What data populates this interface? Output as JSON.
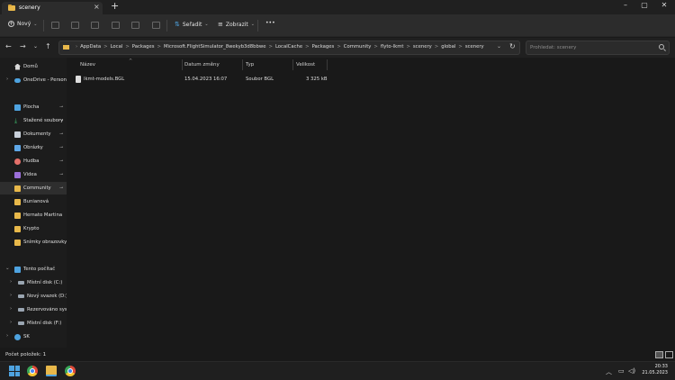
{
  "tab": {
    "title": "scenery",
    "close_label": "×",
    "new_tab_label": "+"
  },
  "window_controls": {
    "minimize": "–",
    "maximize": "▢",
    "close": "✕"
  },
  "toolbar": {
    "new_label": "Nový",
    "sort_label": "Seřadit",
    "view_label": "Zobrazit",
    "more_label": "•••"
  },
  "nav": {
    "back": "←",
    "forward": "→",
    "recent": "⌄",
    "up": "↑"
  },
  "address": {
    "crumbs": [
      "AppData",
      "Local",
      "Packages",
      "Microsoft.FlightSimulator_8wekyb3d8bbwe",
      "LocalCache",
      "Packages",
      "Community",
      "flyto-lkmt",
      "scenery",
      "global",
      "scenery"
    ],
    "separator": ">",
    "lead": "›",
    "dropdown": "⌄",
    "refresh": "↻"
  },
  "search": {
    "placeholder": "Prohledat: scenery"
  },
  "sidebar": {
    "items": [
      {
        "label": "Domů"
      },
      {
        "label": "OneDrive - Persona"
      },
      {
        "label": "Plocha"
      },
      {
        "label": "Stažené soubory"
      },
      {
        "label": "Dokumenty"
      },
      {
        "label": "Obrázky"
      },
      {
        "label": "Hudba"
      },
      {
        "label": "Videa"
      },
      {
        "label": "Community"
      },
      {
        "label": "Bunianová"
      },
      {
        "label": "Hernato Martina"
      },
      {
        "label": "Krypto"
      },
      {
        "label": "Snímky obrazovky"
      },
      {
        "label": "Tento počítač"
      },
      {
        "label": "Místní disk (C:)"
      },
      {
        "label": "Nový svazek (D:)"
      },
      {
        "label": "Rezervováno syste"
      },
      {
        "label": "Místní disk (F:)"
      },
      {
        "label": "SK"
      }
    ],
    "pin_glyph": "📌",
    "expand_closed": "›",
    "expand_open": "⌄"
  },
  "columns": {
    "name": "Název",
    "date": "Datum změny",
    "type": "Typ",
    "size": "Velikost",
    "sort_glyph": "^"
  },
  "files": [
    {
      "name": "lkmt-models.BGL",
      "date": "15.04.2023 16:07",
      "type": "Soubor BGL",
      "size": "3 325 kB"
    }
  ],
  "status": {
    "text": "Počet položek: 1"
  },
  "taskbar": {
    "time": "20:33",
    "date": "21.05.2023",
    "tray_up": "︿"
  },
  "colors": {
    "folder": "#e8b84a",
    "accent": "#4ea3e0",
    "background": "#191919"
  }
}
